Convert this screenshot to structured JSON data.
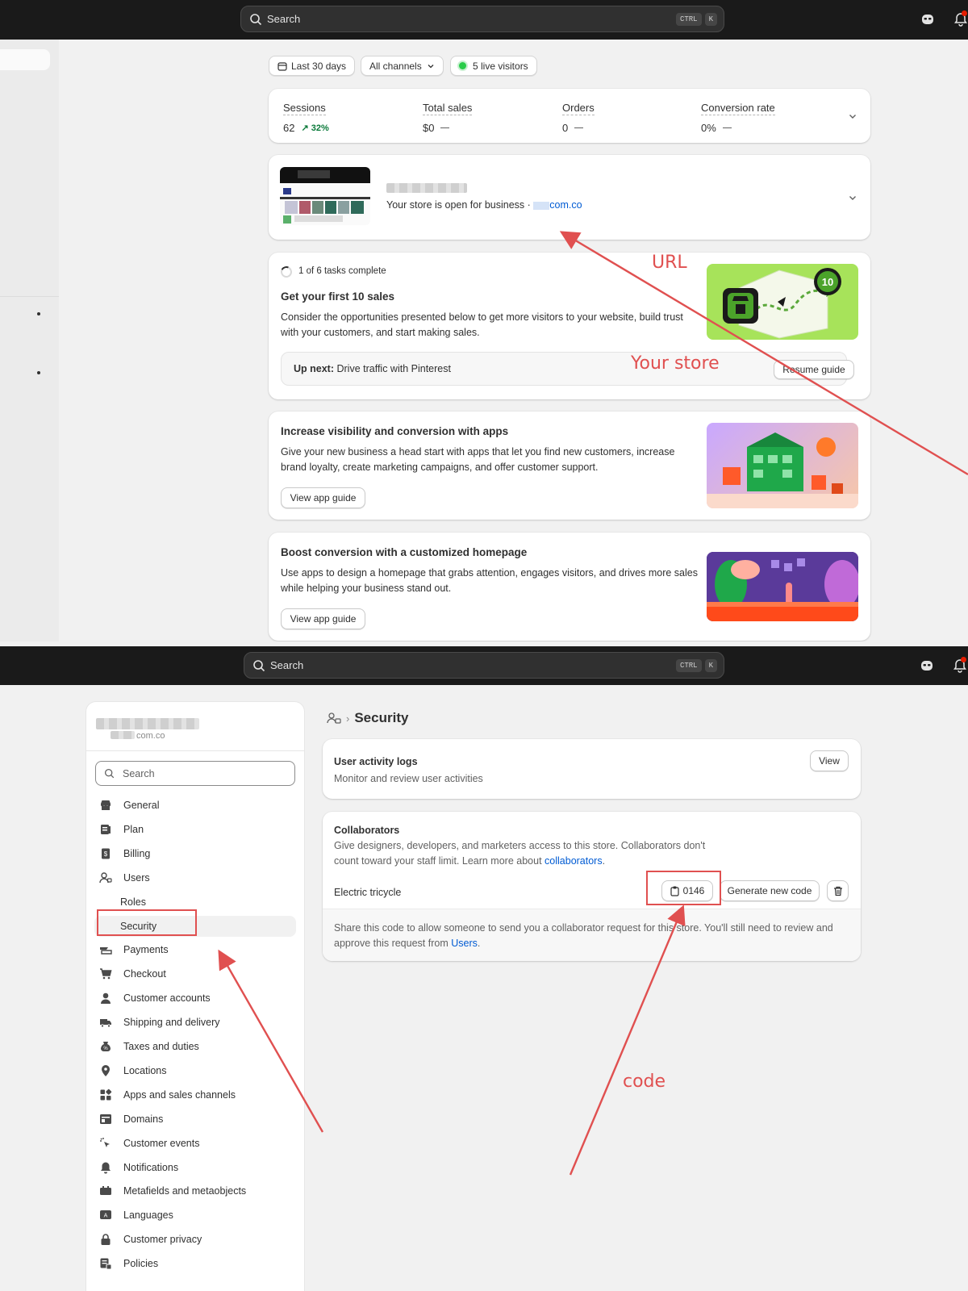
{
  "topbar": {
    "search_label": "Search",
    "shortcut_ctrl": "CTRL",
    "shortcut_key": "K"
  },
  "filters": {
    "date_range": "Last 30 days",
    "channels": "All channels",
    "live_visitors": "5 live visitors"
  },
  "metrics": [
    {
      "label": "Sessions",
      "value": "62",
      "trend": "32%"
    },
    {
      "label": "Total sales",
      "value": "$0"
    },
    {
      "label": "Orders",
      "value": "0"
    },
    {
      "label": "Conversion rate",
      "value": "0%"
    }
  ],
  "store_card": {
    "status_text": "Your store is open for business ·",
    "url_suffix": "com.co"
  },
  "setup_guide": {
    "tasks_count": "1 of 6 tasks complete",
    "title": "Get your first 10 sales",
    "body": "Consider the opportunities presented below to get more visitors to your website, build trust with your customers, and start making sales.",
    "up_next_label": "Up next:",
    "up_next_text": "Drive traffic with Pinterest",
    "resume_button": "Resume guide",
    "badge_text": "10"
  },
  "apps_card": {
    "title": "Increase visibility and conversion with apps",
    "body": "Give your new business a head start with apps that let you find new customers, increase brand loyalty, create marketing campaigns, and offer customer support.",
    "button": "View app guide"
  },
  "homepage_card": {
    "title": "Boost conversion with a customized homepage",
    "body": "Use apps to design a homepage that grabs attention, engages visitors, and drives more sales while helping your business stand out.",
    "button": "View app guide"
  },
  "annotations": {
    "url": "URL",
    "your_store": "Your store",
    "code": "code"
  },
  "settings_sidebar": {
    "shop_url": "com.co",
    "search_placeholder": "Search",
    "items": [
      {
        "label": "General",
        "icon": "store-icon"
      },
      {
        "label": "Plan",
        "icon": "plan-icon"
      },
      {
        "label": "Billing",
        "icon": "billing-icon"
      },
      {
        "label": "Users",
        "icon": "users-icon"
      },
      {
        "label": "Roles",
        "icon": ""
      },
      {
        "label": "Security",
        "icon": ""
      },
      {
        "label": "Payments",
        "icon": "payments-icon"
      },
      {
        "label": "Checkout",
        "icon": "cart-icon"
      },
      {
        "label": "Customer accounts",
        "icon": "person-icon"
      },
      {
        "label": "Shipping and delivery",
        "icon": "truck-icon"
      },
      {
        "label": "Taxes and duties",
        "icon": "tax-icon"
      },
      {
        "label": "Locations",
        "icon": "location-icon"
      },
      {
        "label": "Apps and sales channels",
        "icon": "apps-icon"
      },
      {
        "label": "Domains",
        "icon": "domains-icon"
      },
      {
        "label": "Customer events",
        "icon": "cursor-icon"
      },
      {
        "label": "Notifications",
        "icon": "bell-icon"
      },
      {
        "label": "Metafields and metaobjects",
        "icon": "metafields-icon"
      },
      {
        "label": "Languages",
        "icon": "language-icon"
      },
      {
        "label": "Customer privacy",
        "icon": "lock-icon"
      },
      {
        "label": "Policies",
        "icon": "policies-icon"
      }
    ]
  },
  "security_page": {
    "breadcrumb_page": "Security",
    "activity": {
      "title": "User activity logs",
      "description": "Monitor and review user activities",
      "view_button": "View"
    },
    "collaborators": {
      "title": "Collaborators",
      "description": "Give designers, developers, and marketers access to this store. Collaborators don't count toward your staff limit. Learn more about",
      "link_text": "collaborators",
      "period": ".",
      "store_name": "Electric tricycle",
      "code": "0146",
      "generate_button": "Generate new code",
      "footer_text": "Share this code to allow someone to send you a collaborator request for this store. You'll still need to review and approve this request from",
      "footer_link": "Users",
      "footer_period": "."
    }
  },
  "colors": {
    "accent_link": "#005bd3",
    "annotation_red": "#e05050",
    "topbar": "#1a1a1a",
    "success": "#0a7a3a"
  }
}
